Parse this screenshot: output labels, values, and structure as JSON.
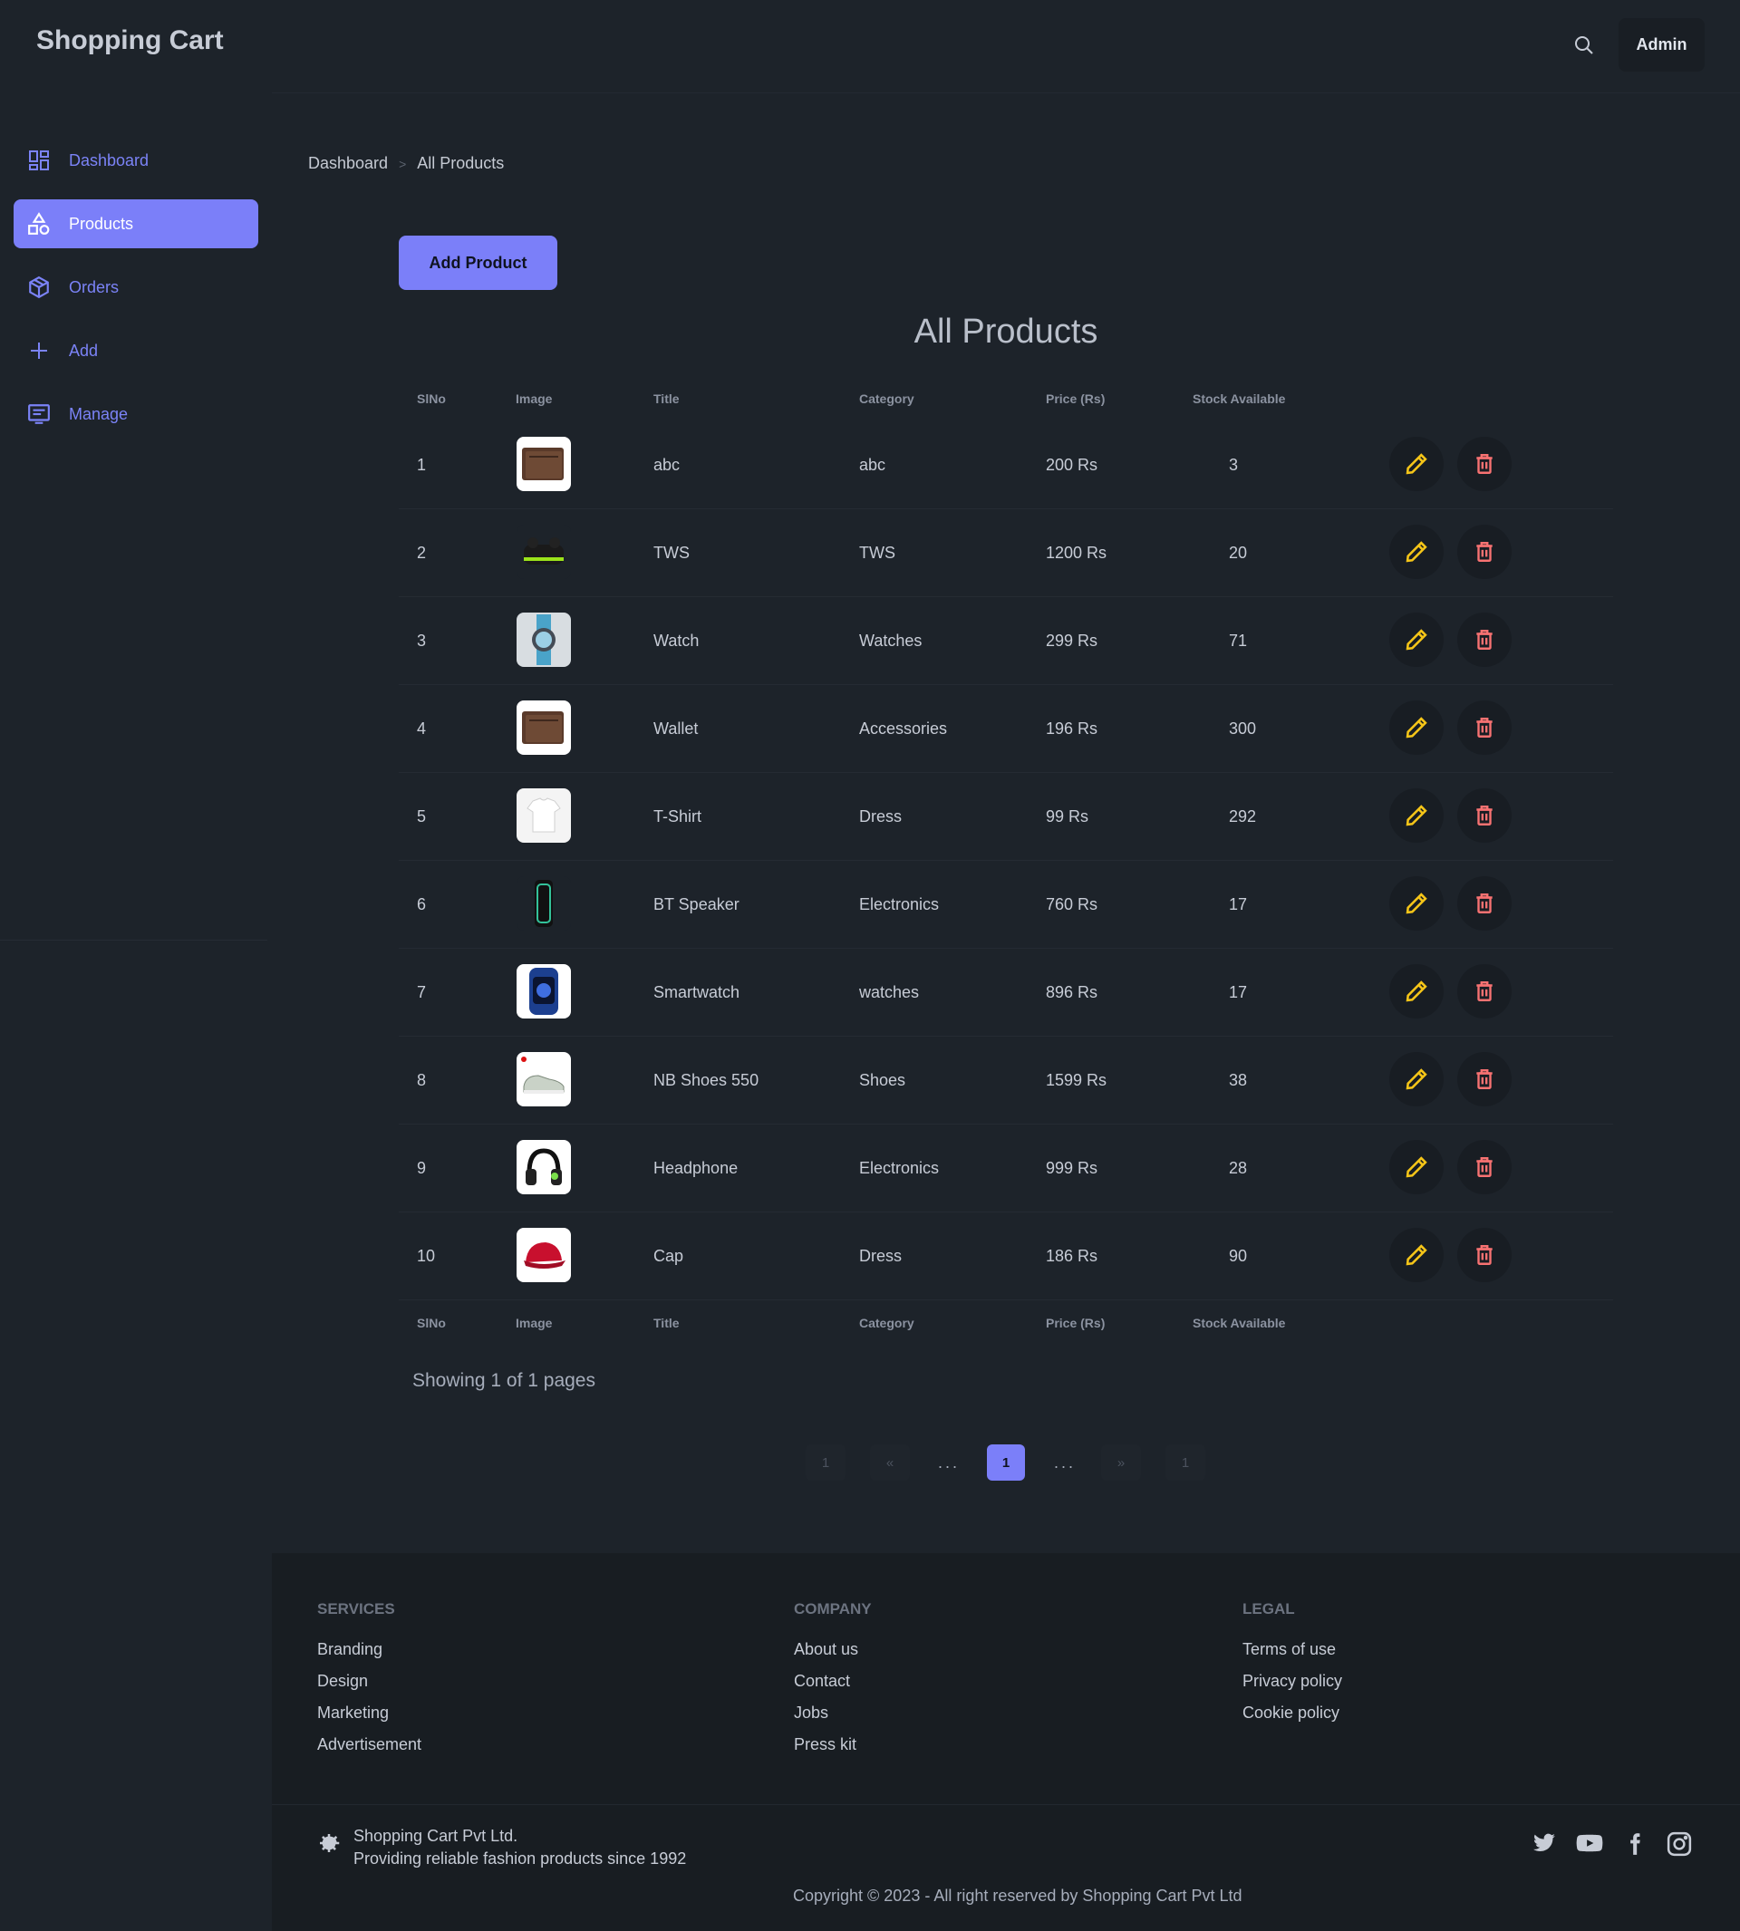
{
  "header": {
    "brand": "Shopping Cart",
    "admin_label": "Admin"
  },
  "sidebar": {
    "items": [
      {
        "label": "Dashboard",
        "icon": "dashboard-grid-icon"
      },
      {
        "label": "Products",
        "icon": "shapes-icon",
        "active": true
      },
      {
        "label": "Orders",
        "icon": "cube-icon"
      },
      {
        "label": "Add",
        "icon": "plus-icon"
      },
      {
        "label": "Manage",
        "icon": "manage-list-icon"
      }
    ]
  },
  "breadcrumb": {
    "home": "Dashboard",
    "current": "All Products"
  },
  "add_product_label": "Add Product",
  "page_title": "All Products",
  "table": {
    "columns": [
      "SlNo",
      "Image",
      "Title",
      "Category",
      "Price (Rs)",
      "Stock Available"
    ],
    "rows": [
      {
        "sl": "1",
        "title": "abc",
        "category": "abc",
        "price": "200 Rs",
        "stock": "3",
        "image": "wallet"
      },
      {
        "sl": "2",
        "title": "TWS",
        "category": "TWS",
        "price": "1200 Rs",
        "stock": "20",
        "image": "earbuds"
      },
      {
        "sl": "3",
        "title": "Watch",
        "category": "Watches",
        "price": "299 Rs",
        "stock": "71",
        "image": "watch"
      },
      {
        "sl": "4",
        "title": "Wallet",
        "category": "Accessories",
        "price": "196 Rs",
        "stock": "300",
        "image": "wallet"
      },
      {
        "sl": "5",
        "title": "T-Shirt",
        "category": "Dress",
        "price": "99 Rs",
        "stock": "292",
        "image": "tshirt"
      },
      {
        "sl": "6",
        "title": "BT Speaker",
        "category": "Electronics",
        "price": "760 Rs",
        "stock": "17",
        "image": "speaker"
      },
      {
        "sl": "7",
        "title": "Smartwatch",
        "category": "watches",
        "price": "896 Rs",
        "stock": "17",
        "image": "smartwatch"
      },
      {
        "sl": "8",
        "title": "NB Shoes 550",
        "category": "Shoes",
        "price": "1599 Rs",
        "stock": "38",
        "image": "shoes"
      },
      {
        "sl": "9",
        "title": "Headphone",
        "category": "Electronics",
        "price": "999 Rs",
        "stock": "28",
        "image": "headphone"
      },
      {
        "sl": "10",
        "title": "Cap",
        "category": "Dress",
        "price": "186 Rs",
        "stock": "90",
        "image": "cap"
      }
    ]
  },
  "showing_text": "Showing 1 of 1 pages",
  "pagination": {
    "first": "1",
    "prev": "«",
    "dots": "...",
    "current": "1",
    "next": "»",
    "last": "1"
  },
  "footer": {
    "columns": [
      {
        "title": "SERVICES",
        "links": [
          "Branding",
          "Design",
          "Marketing",
          "Advertisement"
        ]
      },
      {
        "title": "COMPANY",
        "links": [
          "About us",
          "Contact",
          "Jobs",
          "Press kit"
        ]
      },
      {
        "title": "LEGAL",
        "links": [
          "Terms of use",
          "Privacy policy",
          "Cookie policy"
        ]
      }
    ],
    "company_name": "Shopping Cart Pvt Ltd.",
    "company_tagline": "Providing reliable fashion products since 1992",
    "social": [
      "twitter-icon",
      "youtube-icon",
      "facebook-icon",
      "instagram-icon"
    ],
    "copyright": "Copyright © 2023 - All right reserved by Shopping Cart Pvt Ltd"
  },
  "colors": {
    "accent": "#7b7ff9",
    "edit": "#f5c518",
    "delete": "#f87272",
    "background": "#1d232a"
  }
}
